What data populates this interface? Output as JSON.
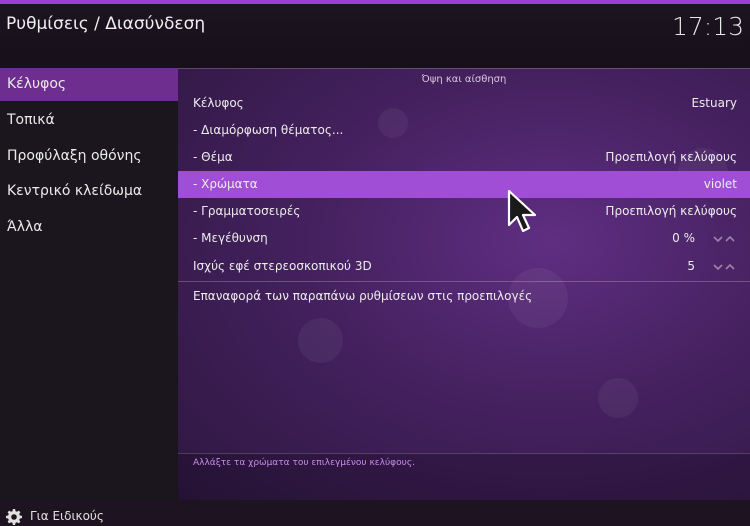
{
  "header": {
    "title": "Ρυθμίσεις / Διασύνδεση",
    "clock": "17:13"
  },
  "sidebar": {
    "items": [
      {
        "label": "Κέλυφος",
        "active": true
      },
      {
        "label": "Τοπικά"
      },
      {
        "label": "Προφύλαξη οθόνης"
      },
      {
        "label": "Κεντρικό κλείδωμα"
      },
      {
        "label": "Άλλα"
      }
    ],
    "footer": "Για Ειδικούς",
    "footer_icon": "gear-icon"
  },
  "settings": {
    "group_title": "Όψη και αίσθηση",
    "rows": [
      {
        "label": "Κέλυφος",
        "value": "Estuary"
      },
      {
        "label": "- Διαμόρφωση θέματος...",
        "value": ""
      },
      {
        "label": "- Θέμα",
        "value": "Προεπιλογή κελύφους"
      },
      {
        "label": "- Χρώματα",
        "value": "violet",
        "selected": true
      },
      {
        "label": "- Γραμματοσειρές",
        "value": "Προεπιλογή κελύφους"
      },
      {
        "label": "- Μεγέθυνση",
        "value": "0 %"
      },
      {
        "label": "Ισχύς εφέ στερεοσκοπικού 3D",
        "value": "5"
      }
    ],
    "reset_label": "Επαναφορά των παραπάνω ρυθμίσεων στις προεπιλογές"
  },
  "status_text": "Αλλάξτε τα χρώματα του επιλεγμένου κελύφους.",
  "colors": {
    "accent": "#9b3fd6",
    "selected_row": "#a14ed6",
    "sidebar_active": "#6d2e8f"
  }
}
